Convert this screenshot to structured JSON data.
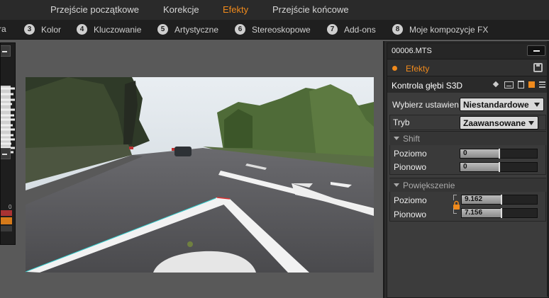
{
  "top_tabs": [
    {
      "label": "Przejście początkowe",
      "active": false
    },
    {
      "label": "Korekcje",
      "active": false
    },
    {
      "label": "Efekty",
      "active": true
    },
    {
      "label": "Przejście końcowe",
      "active": false
    }
  ],
  "categories": [
    {
      "num": "",
      "label": "ra"
    },
    {
      "num": "3",
      "label": "Kolor"
    },
    {
      "num": "4",
      "label": "Kluczowanie"
    },
    {
      "num": "5",
      "label": "Artystyczne"
    },
    {
      "num": "6",
      "label": "Stereoskopowe"
    },
    {
      "num": "7",
      "label": "Add-ons"
    },
    {
      "num": "8",
      "label": "Moje kompozycje FX"
    }
  ],
  "left_panel": {
    "meter_label": "0"
  },
  "panel": {
    "file_name": "00006.MTS",
    "effects_label": "Efekty",
    "effect_title": "Kontrola głębi S3D",
    "preset": {
      "label": "Wybierz ustawien",
      "value": "Niestandardowe"
    },
    "mode": {
      "label": "Tryb",
      "value": "Zaawansowane"
    },
    "shift": {
      "title": "Shift",
      "horizontal": {
        "label": "Poziomo",
        "value": "0",
        "fraction": 0.5
      },
      "vertical": {
        "label": "Pionowo",
        "value": "0",
        "fraction": 0.5
      }
    },
    "zoom": {
      "title": "Powiększenie",
      "horizontal": {
        "label": "Poziomo",
        "value": "9.162",
        "fraction": 0.52
      },
      "vertical": {
        "label": "Pionowo",
        "value": "7.156",
        "fraction": 0.52
      }
    }
  },
  "colors": {
    "accent": "#f08a1c",
    "panel_bg": "#3c3c3c",
    "bar_bg": "#2a2a2a"
  }
}
